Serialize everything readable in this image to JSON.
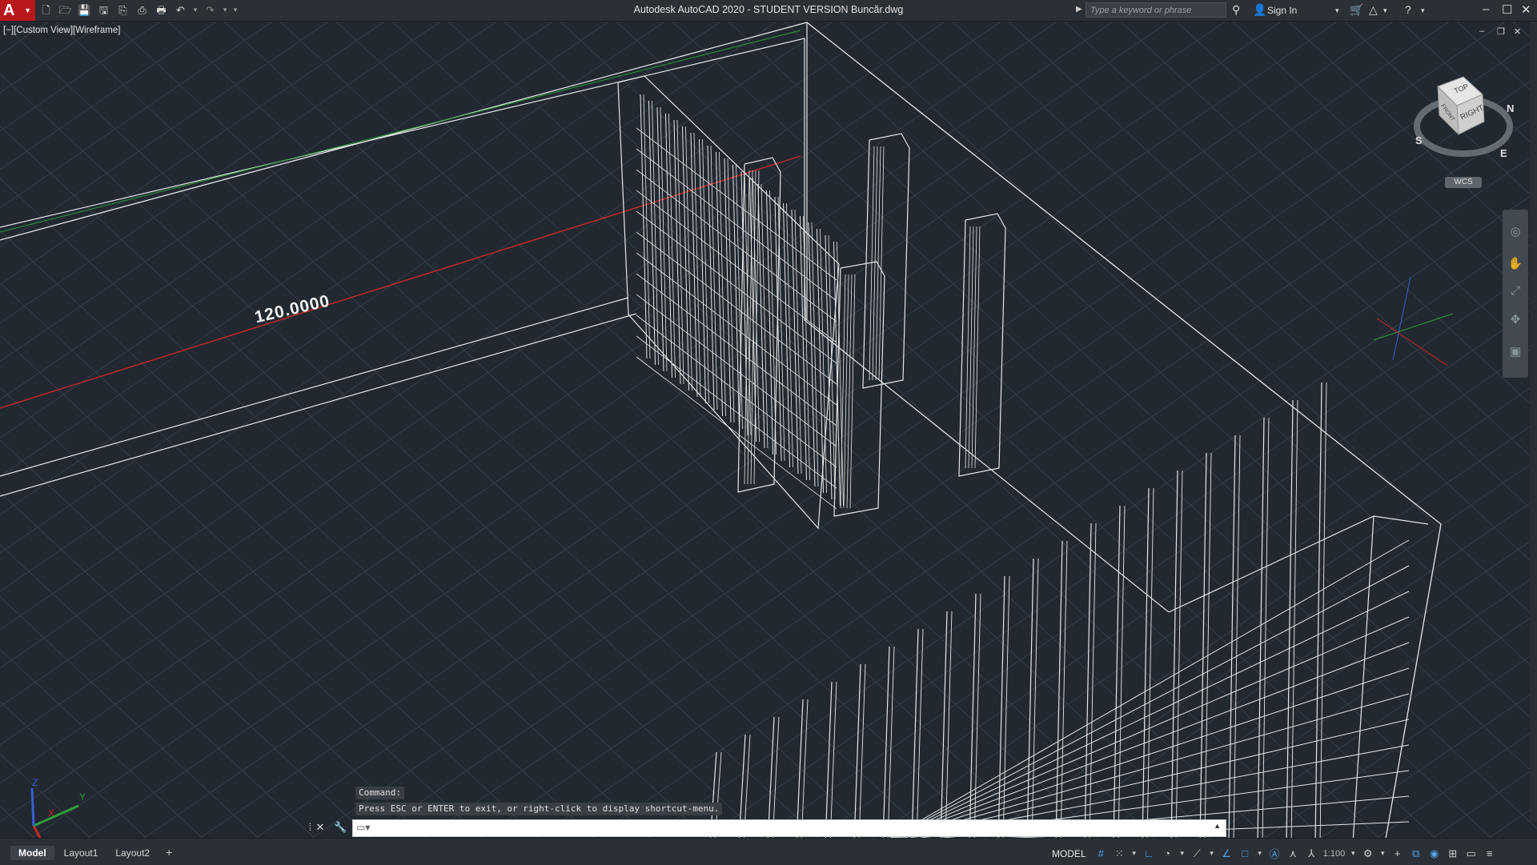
{
  "titlebar": {
    "title": "Autodesk AutoCAD 2020 - STUDENT VERSION     Buncăr.dwg",
    "search_placeholder": "Type a keyword or phrase",
    "signin_label": "Sign In",
    "app_letter": "A",
    "qat_icons": [
      "new-icon",
      "open-icon",
      "save-icon",
      "saveas-icon",
      "publish-icon",
      "plot-preview-icon",
      "print-icon",
      "undo-icon",
      "redo-icon",
      "customize-icon"
    ]
  },
  "viewport": {
    "label": "[−][Custom View][Wireframe]",
    "dimension_text": "120.0000",
    "viewcube": {
      "top": "TOP",
      "right": "RIGHT",
      "front": "FRONT",
      "compass_n": "N",
      "compass_e": "E",
      "compass_s": "S",
      "wcs_label": "WCS"
    },
    "ucs_icon": {
      "x": "X",
      "y": "Y",
      "z": "Z"
    }
  },
  "command": {
    "history_1": "Command:",
    "history_2": "Press ESC or ENTER to exit, or right-click to display shortcut-menu.",
    "input_value": ""
  },
  "status": {
    "tabs": [
      {
        "label": "Model",
        "active": true
      },
      {
        "label": "Layout1",
        "active": false
      },
      {
        "label": "Layout2",
        "active": false
      }
    ],
    "add_tab": "+",
    "model_label": "MODEL",
    "scale": "1:100"
  },
  "colors": {
    "background": "#212830",
    "grid": "#3a424c",
    "geometry": "#e6e6e6",
    "x_axis": "#c62828",
    "y_axis": "#2e9e3a",
    "title_bar": "#2b2f36",
    "app_red": "#b8181c"
  }
}
